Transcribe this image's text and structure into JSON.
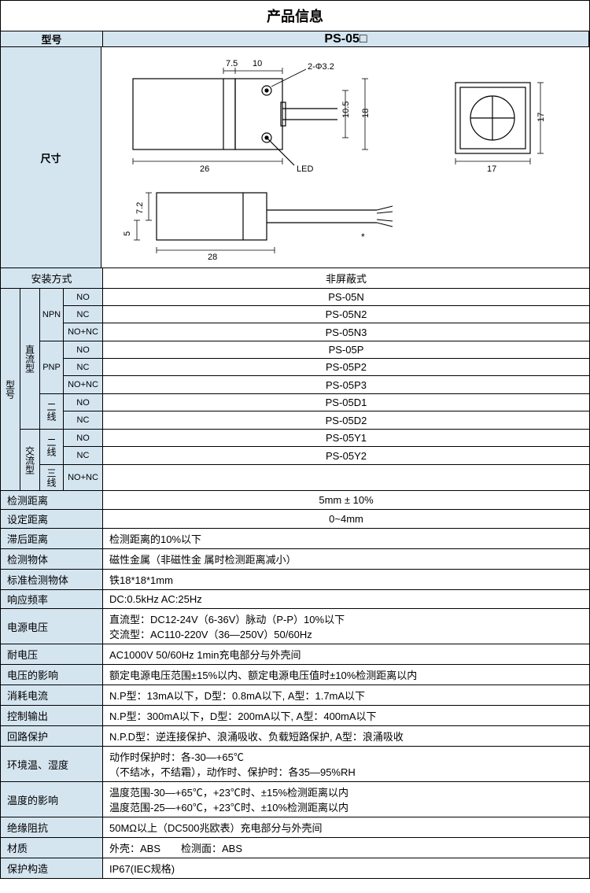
{
  "title": "产品信息",
  "header": {
    "model_label": "型号",
    "model_value": "PS-05□"
  },
  "size": {
    "label": "尺寸"
  },
  "diagram": {
    "d1": "7.5",
    "d2": "10",
    "d3": "2-Φ3.2",
    "d4": "10.5",
    "d5": "18",
    "d6": "26",
    "d7": "LED",
    "d8": "7.2",
    "d9": "5",
    "d10": "28",
    "d11": "*",
    "d12": "17",
    "d13": "17"
  },
  "install": {
    "label": "安装方式",
    "value": "非屏蔽式"
  },
  "models": {
    "group_label": "型号",
    "dc_label": "直流型",
    "ac_label": "交流型",
    "npn": "NPN",
    "pnp": "PNP",
    "two_wire": "二线",
    "three_wire": "三线",
    "no": "NO",
    "nc": "NC",
    "nonc": "NO+NC",
    "npn_no": "PS-05N",
    "npn_nc": "PS-05N2",
    "npn_nonc": "PS-05N3",
    "pnp_no": "PS-05P",
    "pnp_nc": "PS-05P2",
    "pnp_nonc": "PS-05P3",
    "dc2_no": "PS-05D1",
    "dc2_nc": "PS-05D2",
    "ac2_no": "PS-05Y1",
    "ac2_nc": "PS-05Y2",
    "ac3_nonc": ""
  },
  "specs": [
    {
      "label": "检测距离",
      "value": "5mm ± 10%",
      "center": true
    },
    {
      "label": "设定距离",
      "value": "0~4mm",
      "center": true
    },
    {
      "label": "滞后距离",
      "value": "检测距离的10%以下"
    },
    {
      "label": "检测物体",
      "value": "磁性金属（非磁性金 属时检测距离减小）"
    },
    {
      "label": "标准检测物体",
      "value": "铁18*18*1mm"
    },
    {
      "label": "响应频率",
      "value": "DC:0.5kHz AC:25Hz"
    },
    {
      "label": "电源电压",
      "value": "直流型：DC12-24V（6-36V）脉动（P-P）10%以下\n交流型：AC110-220V（36—250V）50/60Hz",
      "multi": true
    },
    {
      "label": "耐电压",
      "value": "AC1000V 50/60Hz 1min充电部分与外壳间"
    },
    {
      "label": "电压的影响",
      "value": "额定电源电压范围±15%以内、额定电源电压值时±10%检测距离以内"
    },
    {
      "label": "消耗电流",
      "value": "N.P型：13mA以下，D型：0.8mA以下, A型：1.7mA以下"
    },
    {
      "label": "控制输出",
      "value": "N.P型：300mA以下，D型：200mA以下, A型：400mA以下"
    },
    {
      "label": "回路保护",
      "value": "N.P.D型：逆连接保护、浪涌吸收、负载短路保护, A型：浪涌吸收"
    },
    {
      "label": "环境温、湿度",
      "value": "动作时保护时：各-30—+65℃\n（不结冰，不结霜），动作时、保护时：各35—95%RH",
      "multi": true
    },
    {
      "label": "温度的影响",
      "value": "温度范围-30—+65℃，+23℃时、±15%检测距离以内\n温度范围-25—+60℃，+23℃时、±10%检测距离以内",
      "multi": true
    },
    {
      "label": "绝缘阻抗",
      "value": "50MΩ以上（DC500兆欧表）充电部分与外壳间"
    },
    {
      "label": "材质",
      "value": "外壳：ABS　　检测面：ABS"
    },
    {
      "label": "保护构造",
      "value": "IP67(IEC规格)"
    }
  ]
}
